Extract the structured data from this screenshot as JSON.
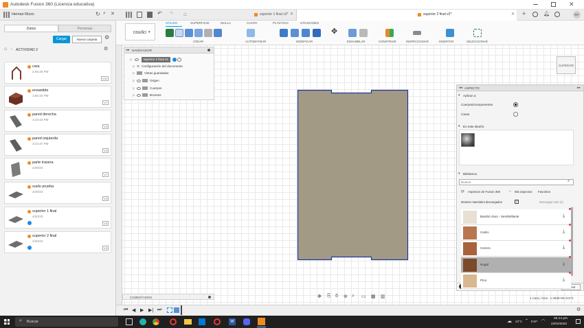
{
  "window": {
    "title": "Autodesk Fusion 360 (Licencia educativa)"
  },
  "left_panel": {
    "team": "Hernan Rizzo",
    "tabs": [
      "Datos",
      "Personas"
    ],
    "upload_label": "Cargar",
    "new_folder_label": "Nueva carpeta",
    "breadcrumb": "ACTIVIDAD 2",
    "files": [
      {
        "name": "cara",
        "date": "2:55:25 PM",
        "version": "V11"
      },
      {
        "name": "ensamble",
        "date": "1:50:33 PM",
        "version": "V7"
      },
      {
        "name": "pared derecha",
        "date": "3:23:18 PM",
        "version": "V3"
      },
      {
        "name": "pared izquierda",
        "date": "3:24:37 PM",
        "version": "V3"
      },
      {
        "name": "parte trasera",
        "date": "4/20/23",
        "version": "V7"
      },
      {
        "name": "suelo prueba",
        "date": "4/20/23",
        "version": "V3"
      },
      {
        "name": "superior 1 final",
        "date": "4/20/23",
        "version": "V3"
      },
      {
        "name": "superior 2 final",
        "date": "4/20/23",
        "version": "V3"
      }
    ]
  },
  "doc_tabs": [
    {
      "label": "superior 1 final v3*"
    },
    {
      "label": "superior 2 final v2*"
    }
  ],
  "toolbar": {
    "workspace": "DISEÑO",
    "tabs": [
      "SÓLIDO",
      "SUPERFICIE",
      "MALLA",
      "CHAPA",
      "PLÁSTICO",
      "UTILIDADES"
    ],
    "groups": [
      "CREAR",
      "AUTOMATIZAR",
      "MODIFICAR",
      "ENSAMBLAR",
      "CONSTRUIR",
      "INSPECCIONAR",
      "INSERTAR",
      "SELECCIONAR"
    ]
  },
  "browser": {
    "title": "NAVEGADOR",
    "root": "superior 2 final v2",
    "items": [
      "Configuración del documento",
      "Vistas guardadas",
      "Origen",
      "Cuerpos",
      "Bocetos"
    ]
  },
  "viewcube": {
    "label": "SUPERIOR"
  },
  "appearance": {
    "title": "ASPECTO",
    "section_apply": "Aplicar a:",
    "options": [
      "Cuerpos/componentes",
      "Caras"
    ],
    "section_in_design": "En este diseño",
    "section_library": "Biblioteca",
    "search_placeholder": "Buscar",
    "library_tabs": [
      "Aspectos de Fusion 360",
      "Mis aspectos",
      "Favoritos"
    ],
    "show_downloaded": "Mostrar materiales descargados",
    "download_all": "Descargar todo (2)",
    "materials": [
      {
        "name": "Bambú claro - Semibrillante",
        "color": "#e8e0d2"
      },
      {
        "name": "Cedro",
        "color": "#b8764f"
      },
      {
        "name": "Cerezo",
        "color": "#a8623c"
      },
      {
        "name": "Nogal",
        "color": "#7a4a2a"
      },
      {
        "name": "Pino",
        "color": "#d8b890"
      }
    ],
    "close_label": "Cerrar"
  },
  "comments_label": "COMENTARIOS",
  "status_text": "1 Cara | Área : 1.2928+05 mm^2",
  "taskbar": {
    "search_label": "Buscar",
    "weather": "23°C",
    "lang": "ESP",
    "time": "05:14 pm",
    "date": "22/04/2023"
  },
  "colors": {
    "accent": "#0696d7",
    "upload": "#0696d7",
    "part_fill": "#a39a86",
    "part_edge": "#1e3799"
  }
}
